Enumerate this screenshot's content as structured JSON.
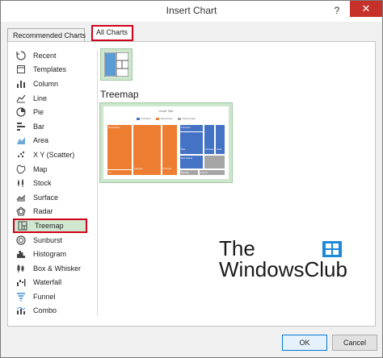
{
  "window": {
    "title": "Insert Chart",
    "help": "?",
    "close": "✕"
  },
  "tabs": [
    {
      "label": "Recommended Charts"
    },
    {
      "label": "All Charts"
    }
  ],
  "sidebar": {
    "items": [
      {
        "label": "Recent",
        "icon": "recent-icon"
      },
      {
        "label": "Templates",
        "icon": "templates-icon"
      },
      {
        "label": "Column",
        "icon": "column-chart-icon"
      },
      {
        "label": "Line",
        "icon": "line-chart-icon"
      },
      {
        "label": "Pie",
        "icon": "pie-chart-icon"
      },
      {
        "label": "Bar",
        "icon": "bar-chart-icon"
      },
      {
        "label": "Area",
        "icon": "area-chart-icon"
      },
      {
        "label": "X Y (Scatter)",
        "icon": "scatter-chart-icon"
      },
      {
        "label": "Map",
        "icon": "map-chart-icon"
      },
      {
        "label": "Stock",
        "icon": "stock-chart-icon"
      },
      {
        "label": "Surface",
        "icon": "surface-chart-icon"
      },
      {
        "label": "Radar",
        "icon": "radar-chart-icon"
      },
      {
        "label": "Treemap",
        "icon": "treemap-chart-icon",
        "selected": true
      },
      {
        "label": "Sunburst",
        "icon": "sunburst-chart-icon"
      },
      {
        "label": "Histogram",
        "icon": "histogram-chart-icon"
      },
      {
        "label": "Box & Whisker",
        "icon": "box-whisker-chart-icon"
      },
      {
        "label": "Waterfall",
        "icon": "waterfall-chart-icon"
      },
      {
        "label": "Funnel",
        "icon": "funnel-chart-icon"
      },
      {
        "label": "Combo",
        "icon": "combo-chart-icon"
      }
    ]
  },
  "main": {
    "subtype_title": "Treemap",
    "preview": {
      "chart_title": "Chart Title",
      "legend": [
        "Furniture",
        "Electronics",
        "Kitchenware"
      ],
      "tiles": {
        "t1": "Bookcases",
        "t2": "Laptops",
        "t3": "Phones",
        "t4": "Bed",
        "t5": "Furniture",
        "t6": "Dresser",
        "t7": "Sofa",
        "t8": "Bed Stand",
        "t9": "Blender",
        "t10": "Knives",
        "t11": "Tv"
      }
    }
  },
  "colors": {
    "orange": "#ed7d31",
    "blue": "#4472c4",
    "gray": "#a5a5a5",
    "accent_red": "#d0021b",
    "selected_green": "#cfe8cf"
  },
  "watermark": {
    "line1": "The",
    "line2": "WindowsClub"
  },
  "buttons": {
    "ok": "OK",
    "cancel": "Cancel"
  }
}
